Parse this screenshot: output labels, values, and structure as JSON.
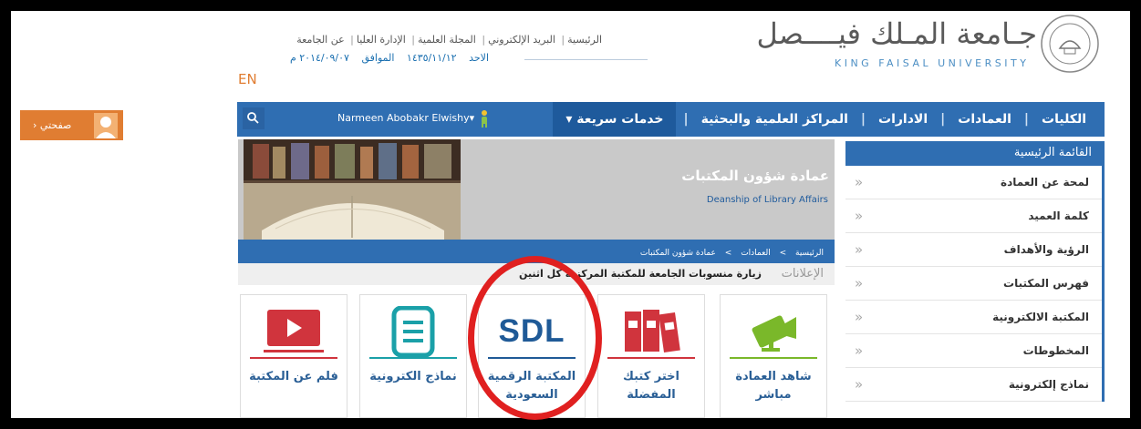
{
  "profile": {
    "label": "› صفحتي"
  },
  "header": {
    "lang_switch": "EN",
    "links": [
      "الرئيسية",
      "البريد الإلكتروني",
      "المجلة العلمية",
      "الإدارة العليا",
      "عن الجامعة"
    ],
    "date_day": "الاحد",
    "date_hijri": "١٤٣٥/١١/١٢",
    "date_agree": "الموافق",
    "date_greg": "٢٠١٤/٠٩/٠٧ م",
    "university_ar": "جـامعة المـلك فيــــصل",
    "university_en": "KING FAISAL UNIVERSITY"
  },
  "navbar": {
    "user": "Narmeen Abobakr Elwishy▾",
    "items": [
      "الكليات",
      "العمادات",
      "الادارات",
      "المراكز العلمية والبحثية"
    ],
    "quick": "خدمات سريعة ▾"
  },
  "sidebar": {
    "title": "القائمة الرئيسية",
    "chevron": "«",
    "items": [
      "لمحة عن العمادة",
      "كلمة العميد",
      "الرؤية والأهداف",
      "فهرس المكتبات",
      "المكتبة الالكترونية",
      "المخطوطات",
      "نماذج إلكترونية"
    ]
  },
  "banner": {
    "title": "عمادة شؤون المكتبات",
    "subtitle": "Deanship of Library Affairs"
  },
  "breadcrumb": {
    "items": [
      "الرئيسية",
      "العمادات",
      "عمادة شؤون المكتبات"
    ],
    "sep": ">"
  },
  "announcements": {
    "label": "الإعلانات",
    "text": "زيارة منسوبات الجامعة للمكتبة المركزية كل اثنين"
  },
  "tiles": [
    {
      "label": "شاهد العمادة مباشر",
      "icon": "camera-icon",
      "color": "#7ab82a"
    },
    {
      "label": "اختر كتبك المفضلة",
      "icon": "books-icon",
      "color": "#d0343d"
    },
    {
      "label": "المكتبة الرقمية السعودية",
      "icon": "sdl-logo",
      "logo_text": "SDL",
      "color": "#1f5a97"
    },
    {
      "label": "نماذج الكترونية",
      "icon": "document-icon",
      "color": "#1aa0a8"
    },
    {
      "label": "فلم عن المكتبة",
      "icon": "video-icon",
      "color": "#d0343d"
    }
  ]
}
